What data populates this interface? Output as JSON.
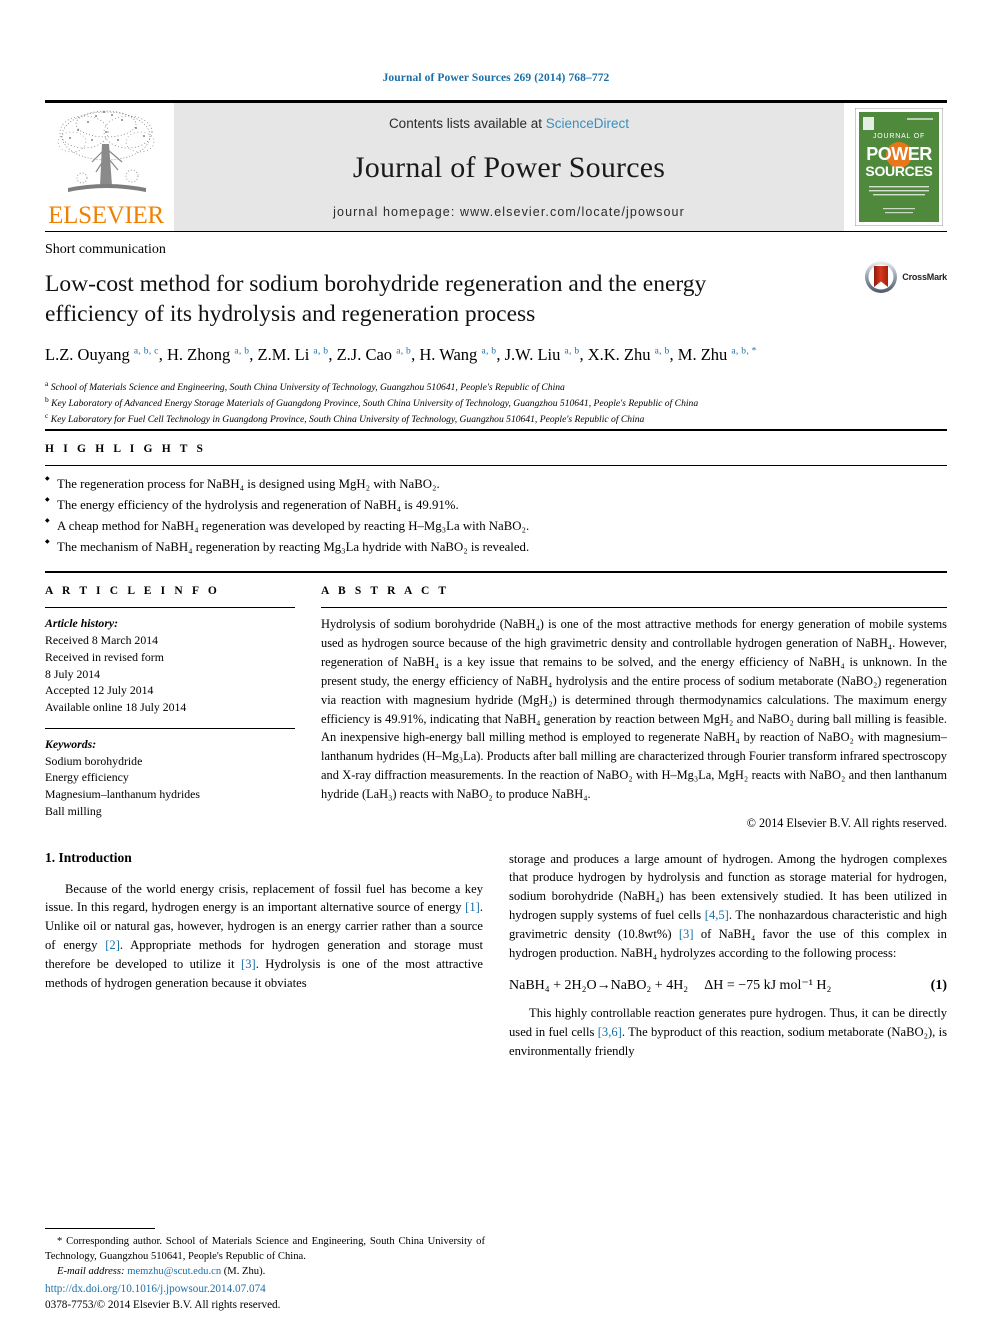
{
  "citation": "Journal of Power Sources 269 (2014) 768–772",
  "masthead": {
    "publisher_word": "ELSEVIER",
    "contents_prefix": "Contents lists available at ",
    "sciencedirect": "ScienceDirect",
    "journal_name": "Journal of Power Sources",
    "homepage": "journal homepage: www.elsevier.com/locate/jpowsour",
    "cover_line1": "JOURNAL OF",
    "cover_line2": "POWER",
    "cover_line3": "SOURCES"
  },
  "article": {
    "doctype": "Short communication",
    "title": "Low-cost method for sodium borohydride regeneration and the energy efficiency of its hydrolysis and regeneration process",
    "crossmark_label": "CrossMark",
    "authors": [
      {
        "name": "L.Z. Ouyang",
        "marks": "a, b, c"
      },
      {
        "name": "H. Zhong",
        "marks": "a, b"
      },
      {
        "name": "Z.M. Li",
        "marks": "a, b"
      },
      {
        "name": "Z.J. Cao",
        "marks": "a, b"
      },
      {
        "name": "H. Wang",
        "marks": "a, b"
      },
      {
        "name": "J.W. Liu",
        "marks": "a, b"
      },
      {
        "name": "X.K. Zhu",
        "marks": "a, b"
      },
      {
        "name": "M. Zhu",
        "marks": "a, b, *"
      }
    ],
    "affiliations": [
      {
        "mark": "a",
        "text": "School of Materials Science and Engineering, South China University of Technology, Guangzhou 510641, People's Republic of China"
      },
      {
        "mark": "b",
        "text": "Key Laboratory of Advanced Energy Storage Materials of Guangdong Province, South China University of Technology, Guangzhou 510641, People's Republic of China"
      },
      {
        "mark": "c",
        "text": "Key Laboratory for Fuel Cell Technology in Guangdong Province, South China University of Technology, Guangzhou 510641, People's Republic of China"
      }
    ]
  },
  "highlights": {
    "label": "H I G H L I G H T S",
    "items": [
      "The regeneration process for NaBH₄ is designed using MgH₂ with NaBO₂.",
      "The energy efficiency of the hydrolysis and regeneration of NaBH₄ is 49.91%.",
      "A cheap method for NaBH₄ regeneration was developed by reacting H–Mg₃La with NaBO₂.",
      "The mechanism of NaBH₄ regeneration by reacting Mg₃La hydride with NaBO₂ is revealed."
    ]
  },
  "article_info": {
    "label": "A R T I C L E   I N F O",
    "history_label": "Article history:",
    "history": [
      "Received 8 March 2014",
      "Received in revised form",
      "8 July 2014",
      "Accepted 12 July 2014",
      "Available online 18 July 2014"
    ],
    "keywords_label": "Keywords:",
    "keywords": [
      "Sodium borohydride",
      "Energy efficiency",
      "Magnesium–lanthanum hydrides",
      "Ball milling"
    ]
  },
  "abstract": {
    "label": "A B S T R A C T",
    "text": "Hydrolysis of sodium borohydride (NaBH₄) is one of the most attractive methods for energy generation of mobile systems used as hydrogen source because of the high gravimetric density and controllable hydrogen generation of NaBH₄. However, regeneration of NaBH₄ is a key issue that remains to be solved, and the energy efficiency of NaBH₄ is unknown. In the present study, the energy efficiency of NaBH₄ hydrolysis and the entire process of sodium metaborate (NaBO₂) regeneration via reaction with magnesium hydride (MgH₂) is determined through thermodynamics calculations. The maximum energy efficiency is 49.91%, indicating that NaBH₄ generation by reaction between MgH₂ and NaBO₂ during ball milling is feasible. An inexpensive high-energy ball milling method is employed to regenerate NaBH₄ by reaction of NaBO₂ with magnesium–lanthanum hydrides (H–Mg₃La). Products after ball milling are characterized through Fourier transform infrared spectroscopy and X-ray diffraction measurements. In the reaction of NaBO₂ with H–Mg₃La, MgH₂ reacts with NaBO₂ and then lanthanum hydride (LaH₃) reacts with NaBO₂ to produce NaBH₄.",
    "copyright": "© 2014 Elsevier B.V. All rights reserved."
  },
  "introduction": {
    "heading": "1.  Introduction",
    "left_paragraph_1": "Because of the world energy crisis, replacement of fossil fuel has become a key issue. In this regard, hydrogen energy is an important alternative source of energy ",
    "left_ref_1": "[1]",
    "left_paragraph_1b": ". Unlike oil or natural gas, however, hydrogen is an energy carrier rather than a source of energy ",
    "left_ref_2": "[2]",
    "left_paragraph_1c": ". Appropriate methods for hydrogen generation and storage must therefore be developed to utilize it ",
    "left_ref_3": "[3]",
    "left_paragraph_1d": ". Hydrolysis is one of the most attractive methods of hydrogen generation because it obviates",
    "right_paragraph_1": "storage and produces a large amount of hydrogen. Among the hydrogen complexes that produce hydrogen by hydrolysis and function as storage material for hydrogen, sodium borohydride (NaBH₄) has been extensively studied. It has been utilized in hydrogen supply systems of fuel cells ",
    "right_ref_1": "[4,5]",
    "right_paragraph_1b": ". The nonhazardous characteristic and high gravimetric density (10.8wt%) ",
    "right_ref_2": "[3]",
    "right_paragraph_1c": " of NaBH₄ favor the use of this complex in hydrogen production. NaBH₄ hydrolyzes according to the following process:",
    "equation": {
      "main": "NaBH₄ + 2H₂O→NaBO₂ + 4H₂",
      "delta_h": "ΔH = −75 kJ mol⁻¹ H₂",
      "number": "(1)"
    },
    "right_paragraph_2": "This highly controllable reaction generates pure hydrogen. Thus, it can be directly used in fuel cells ",
    "right_ref_3": "[3,6]",
    "right_paragraph_2b": ". The byproduct of this reaction, sodium metaborate (NaBO₂), is environmentally friendly"
  },
  "footer": {
    "corresponding_marker": "*",
    "corresponding_text": " Corresponding author. School of Materials Science and Engineering, South China University of Technology, Guangzhou 510641, People's Republic of China.",
    "email_label": "E-mail address:",
    "email": "memzhu@scut.edu.cn",
    "email_suffix": " (M. Zhu).",
    "doi": "http://dx.doi.org/10.1016/j.jpowsour.2014.07.074",
    "issn_line": "0378-7753/© 2014 Elsevier B.V. All rights reserved."
  },
  "colors": {
    "link": "#1a6fa8",
    "sciencedirect": "#3a8fbf",
    "elsevier_orange": "#f08000",
    "cover_green": "#4f8a3c",
    "band_gray": "#e6e6e6"
  }
}
